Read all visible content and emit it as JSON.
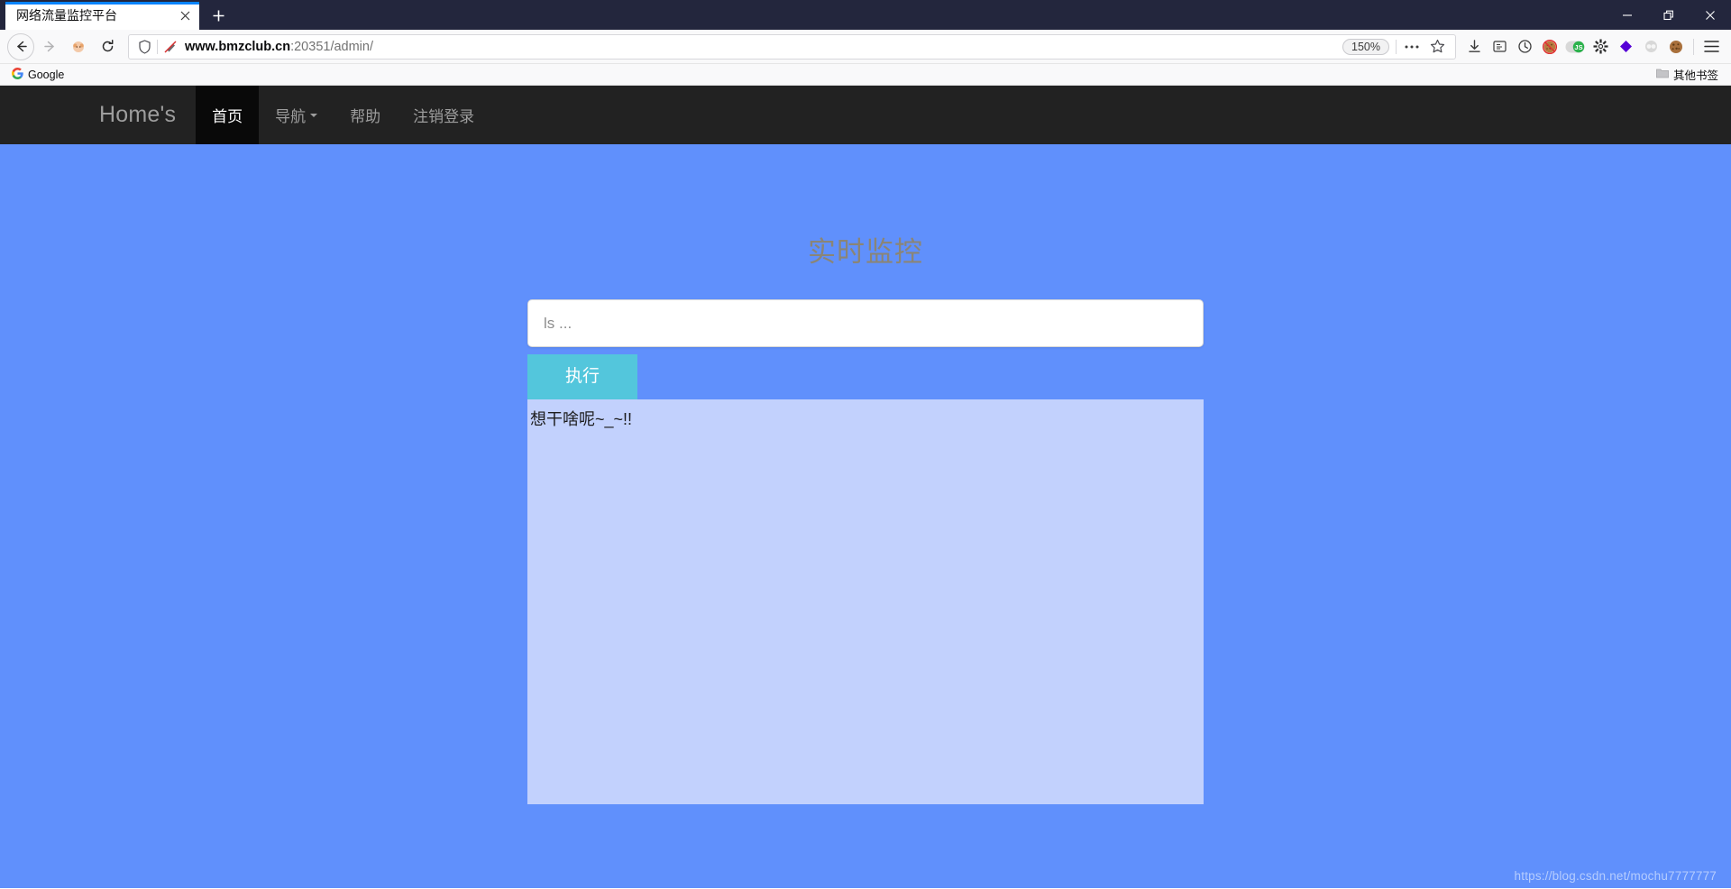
{
  "browser": {
    "tab": {
      "title": "网络流量监控平台",
      "close_icon": "close-icon",
      "newtab_icon": "plus-icon"
    },
    "window_controls": {
      "minimize": "minimize-icon",
      "restore": "restore-icon",
      "close": "close-icon"
    },
    "nav": {
      "back_icon": "back-arrow-icon",
      "forward_icon": "forward-arrow-icon",
      "account_icon": "account-avatar-icon",
      "reload_icon": "reload-icon"
    },
    "url": {
      "shield_icon": "shield-icon",
      "tracker_icon": "tracker-blocked-icon",
      "host": "www.bmzclub.cn",
      "rest": ":20351/admin/",
      "zoom_level": "150%",
      "more_icon": "ellipsis-icon",
      "bookmark_icon": "star-icon"
    },
    "toolbar_icons": [
      {
        "name": "download-icon"
      },
      {
        "name": "reader-mode-icon"
      },
      {
        "name": "history-clock-icon"
      },
      {
        "name": "cookie-blocked-icon"
      },
      {
        "name": "javascript-toggle-icon"
      },
      {
        "name": "gear-icon"
      },
      {
        "name": "diamond-extension-icon"
      },
      {
        "name": "proxy-extension-icon"
      },
      {
        "name": "cookie-manager-icon"
      },
      {
        "name": "hamburger-menu-icon"
      }
    ],
    "bookmarks": {
      "google_label": "Google",
      "google_icon": "google-icon",
      "other_label": "其他书签",
      "other_icon": "folder-icon"
    }
  },
  "site": {
    "navbar": {
      "brand": "Home's",
      "items": [
        {
          "label": "首页",
          "active": true,
          "has_caret": false
        },
        {
          "label": "导航",
          "active": false,
          "has_caret": true
        },
        {
          "label": "帮助",
          "active": false,
          "has_caret": false
        },
        {
          "label": "注销登录",
          "active": false,
          "has_caret": false
        }
      ]
    },
    "main": {
      "title": "实时监控",
      "command_input": {
        "value": "",
        "placeholder": "ls ..."
      },
      "run_button": "执行",
      "output": "想干啥呢~_~!!"
    },
    "watermark": "https://blog.csdn.net/mochu7777777"
  },
  "colors": {
    "page_background": "#6090fc",
    "navbar_background": "#222222",
    "navbar_active": "#090909",
    "button_background": "#53c6dc",
    "output_background": "#c2d1fd",
    "title_color": "#8a8577",
    "titlebar_background": "#23263d",
    "tab_accent": "#0a84ff"
  }
}
